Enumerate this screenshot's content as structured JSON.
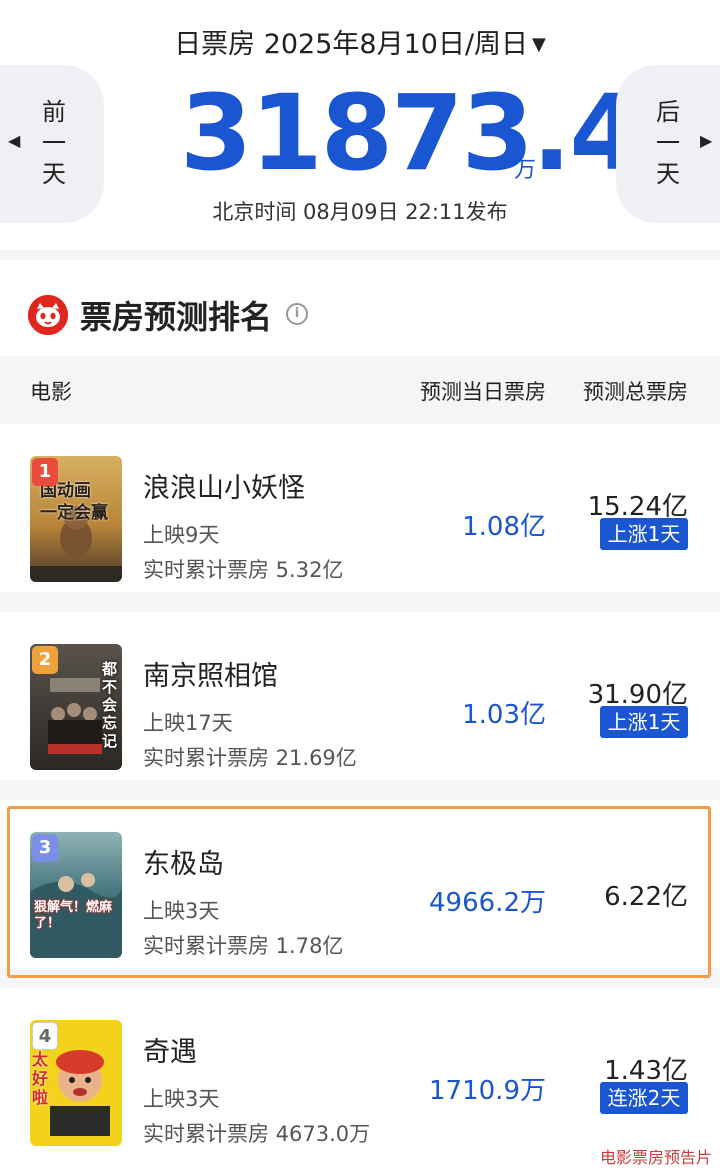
{
  "header": {
    "date_label": "日票房 2025年8月10日/周日",
    "caret": "▼",
    "total_value": "31873.4",
    "total_unit": "万",
    "publish_time": "北京时间  08月09日  22:11发布",
    "prev_label": "前\n一\n天",
    "next_label": "后\n一\n天",
    "prev_arrow": "◀",
    "next_arrow": "▶",
    "accent_color": "#1a55d2"
  },
  "section": {
    "title": "票房预测排名",
    "info_glyph": "i",
    "logo": "maoyan-cat-logo"
  },
  "columns": {
    "movie": "电影",
    "day": "预测当日票房",
    "total": "预测总票房"
  },
  "movies": [
    {
      "rank": "1",
      "title": "浪浪山小妖怪",
      "days": "上映9天",
      "cumulative": "实时累计票房 5.32亿",
      "day_forecast": "1.08亿",
      "total_forecast": "15.24亿",
      "trend": "上涨1天",
      "poster_text": "国动画\n一定会赢",
      "poster_bg": "#c9953a"
    },
    {
      "rank": "2",
      "title": "南京照相馆",
      "days": "上映17天",
      "cumulative": "实时累计票房 21.69亿",
      "day_forecast": "1.03亿",
      "total_forecast": "31.90亿",
      "trend": "上涨1天",
      "poster_text": "都\n不\n会\n忘\n记",
      "poster_bg": "#3a3632"
    },
    {
      "rank": "3",
      "title": "东极岛",
      "days": "上映3天",
      "cumulative": "实时累计票房 1.78亿",
      "day_forecast": "4966.2万",
      "total_forecast": "6.22亿",
      "trend": "",
      "poster_text": "狠解气！燃麻了！",
      "poster_bg": "#3f6f78"
    },
    {
      "rank": "4",
      "title": "奇遇",
      "days": "上映3天",
      "cumulative": "实时累计票房 4673.0万",
      "day_forecast": "1710.9万",
      "total_forecast": "1.43亿",
      "trend": "连涨2天",
      "poster_text": "太\n好\n啦",
      "poster_bg": "#f2d21c"
    }
  ],
  "watermark": "电影票房预告片"
}
